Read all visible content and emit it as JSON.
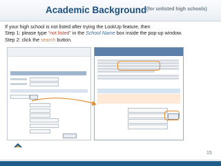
{
  "slide": {
    "title": "Academic Background",
    "subtitle": "(for unlisted high schools)",
    "line1": "If your high school is not listed after trying the LookUp feature, then",
    "step1_prefix": "Step 1: please type ",
    "step1_value": "“not listed”",
    "step1_mid": " in the ",
    "step1_field": "School Name",
    "step1_suffix": " box inside the pop-up window.",
    "step2_prefix": "Step 2: click the ",
    "step2_action": "search",
    "step2_suffix": " button.",
    "page_number": "15"
  },
  "colors": {
    "title": "#1d4f7c",
    "highlight_red": "#c0392b",
    "highlight_blue": "#2b6cb0",
    "highlight_orange": "#e07b24",
    "footer": "#1f5c8a"
  },
  "icons": [
    "application-form-screenshot",
    "lookup-popup-screenshot",
    "nova-logo",
    "arrow-icon"
  ]
}
